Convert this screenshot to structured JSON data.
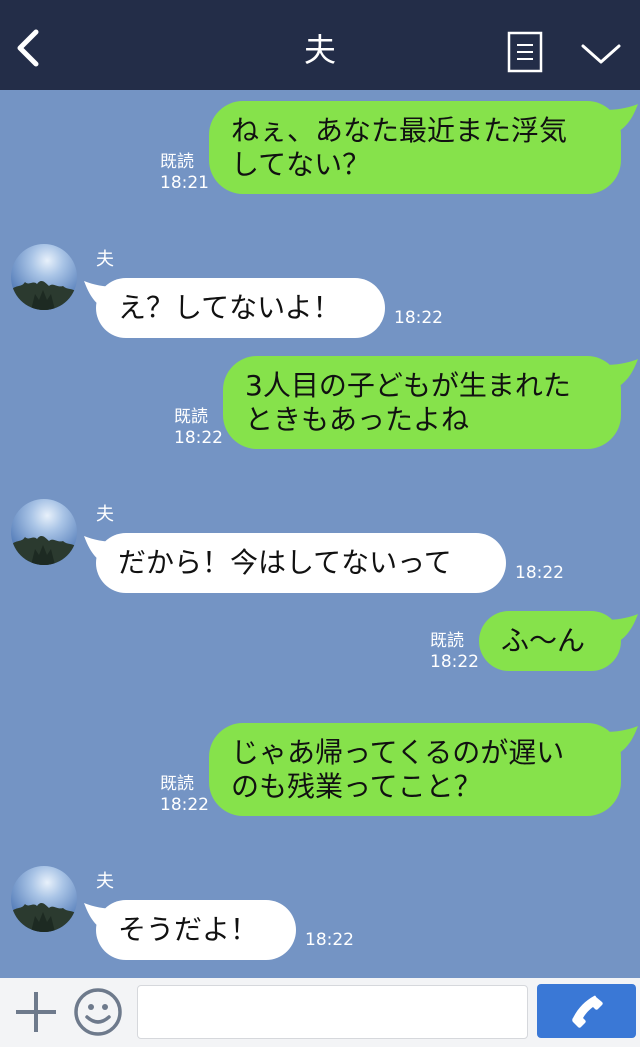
{
  "header": {
    "title": "夫",
    "back_icon": "chevron-left-icon",
    "menu_icon": "list-icon",
    "collapse_icon": "chevron-down-icon",
    "bg_color": "#232d48"
  },
  "colors": {
    "chat_bg": "#7494c4",
    "my_bubble": "#86e24b",
    "their_bubble": "#ffffff",
    "send_button": "#3a78d6"
  },
  "messages": [
    {
      "from": "me",
      "lines": [
        "ねぇ、あなた最近また浮気",
        "してない？"
      ],
      "read": "既読",
      "time": "18:21"
    },
    {
      "from": "them",
      "sender": "夫",
      "lines": [
        "え？してないよ！"
      ],
      "time": "18:22"
    },
    {
      "from": "me",
      "lines": [
        "3人目の子どもが生まれた",
        "ときもあったよね"
      ],
      "read": "既読",
      "time": "18:22"
    },
    {
      "from": "them",
      "sender": "夫",
      "lines": [
        "だから！今はしてないって"
      ],
      "time": "18:22"
    },
    {
      "from": "me",
      "lines": [
        "ふ〜ん"
      ],
      "read": "既読",
      "time": "18:22"
    },
    {
      "from": "me",
      "lines": [
        "じゃあ帰ってくるのが遅い",
        "のも残業ってこと？"
      ],
      "read": "既読",
      "time": "18:22"
    },
    {
      "from": "them",
      "sender": "夫",
      "lines": [
        "そうだよ！"
      ],
      "time": "18:22"
    }
  ],
  "composer": {
    "plus_icon": "plus-icon",
    "emoji_icon": "smiley-icon",
    "input_value": "",
    "input_placeholder": "",
    "call_icon": "phone-icon"
  }
}
